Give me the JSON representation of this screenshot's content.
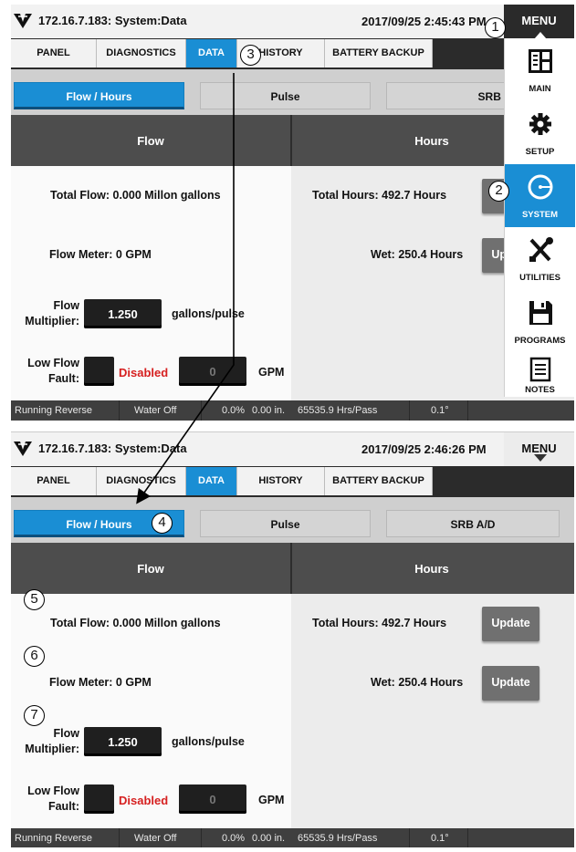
{
  "screens": [
    {
      "title": "172.16.7.183: System:Data",
      "datetime": "2017/09/25 2:45:43 PM",
      "menu_label": "MENU",
      "tabs": [
        "PANEL",
        "DIAGNOSTICS",
        "DATA",
        "HISTORY",
        "BATTERY BACKUP"
      ],
      "active_tab": "DATA",
      "subtabs": [
        "Flow / Hours",
        "Pulse",
        "SRB A/D"
      ]
    },
    {
      "title": "172.16.7.183: System:Data",
      "datetime": "2017/09/25 2:46:26 PM",
      "menu_label": "MENU",
      "tabs": [
        "PANEL",
        "DIAGNOSTICS",
        "DATA",
        "HISTORY",
        "BATTERY BACKUP"
      ],
      "active_tab": "DATA",
      "subtabs": [
        "Flow / Hours",
        "Pulse",
        "SRB A/D"
      ]
    }
  ],
  "table": {
    "flow_header": "Flow",
    "hours_header": "Hours",
    "total_flow": "Total Flow: 0.000 Millon gallons",
    "flow_meter": "Flow Meter: 0 GPM",
    "flow_multiplier_label_1": "Flow",
    "flow_multiplier_label_2": "Multiplier:",
    "flow_multiplier_value": "1.250",
    "flow_multiplier_unit": "gallons/pulse",
    "low_flow_label_1": "Low Flow",
    "low_flow_label_2": "Fault:",
    "low_flow_status": "Disabled",
    "low_flow_value": "0",
    "low_flow_unit": "GPM",
    "total_hours": "Total Hours: 492.7 Hours",
    "wet_hours": "Wet: 250.4 Hours",
    "update_label": "Update"
  },
  "status_bar": {
    "direction": "Running Reverse",
    "water": "Water Off",
    "percent": "0.0%",
    "depth": "0.00 in.",
    "hrs_pass": "65535.9 Hrs/Pass",
    "angle": "0.1°"
  },
  "side_menu": {
    "items": [
      {
        "label": "MAIN",
        "icon": "main-panel-icon"
      },
      {
        "label": "SETUP",
        "icon": "gear-icon"
      },
      {
        "label": "SYSTEM",
        "icon": "system-circle-icon"
      },
      {
        "label": "UTILITIES",
        "icon": "tools-icon"
      },
      {
        "label": "PROGRAMS",
        "icon": "floppy-disk-icon"
      },
      {
        "label": "NOTES",
        "icon": "notes-icon"
      }
    ],
    "active": "SYSTEM"
  },
  "callouts": [
    "1",
    "2",
    "3",
    "4",
    "5",
    "6",
    "7"
  ],
  "colors": {
    "accent_blue": "#1a8ed4",
    "header_dark": "#4d4d4d",
    "disabled_red": "#d62020",
    "status_bar": "#3f3f3f"
  }
}
